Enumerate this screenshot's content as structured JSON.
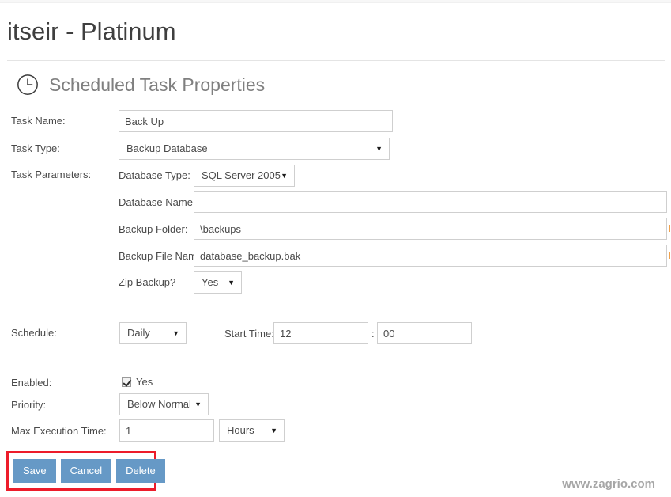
{
  "window": {
    "brand": "itseir - Platinum",
    "page_title": "Scheduled Task Properties",
    "title_icon": "clock-icon"
  },
  "form": {
    "task_name": {
      "label": "Task Name:",
      "value": "Back Up",
      "placeholder": ""
    },
    "task_type": {
      "label": "Task Type:",
      "value": "Backup Database",
      "caret": "▼"
    },
    "task_parameters": {
      "label": "Task Parameters:",
      "database_type": {
        "label": "Database Type:",
        "value": "SQL Server 2005",
        "caret": "▼"
      },
      "database_name": {
        "label": "Database Name:",
        "value": "",
        "placeholder": ""
      },
      "backup_folder": {
        "label": "Backup Folder:",
        "value": "\\backups",
        "placeholder": ""
      },
      "backup_file_name": {
        "label": "Backup File Name:",
        "value": "database_backup.bak",
        "placeholder": ""
      },
      "zip_backup": {
        "label": "Zip Backup?",
        "value": "Yes",
        "caret": "▼"
      }
    },
    "schedule": {
      "label": "Schedule:",
      "value": "Daily",
      "caret": "▼"
    },
    "start_time": {
      "label": "Start Time:",
      "hours": "12",
      "separator": ":",
      "minutes": "00"
    },
    "enabled": {
      "label": "Enabled:",
      "checkbox_label": "Yes",
      "checked": true
    },
    "priority": {
      "label": "Priority:",
      "value": "Below Normal",
      "caret": "▼"
    },
    "max_execution_time": {
      "label": "Max Execution Time:",
      "value": "1",
      "unit": "Hours",
      "caret": "▼"
    }
  },
  "actions": {
    "save": "Save",
    "cancel": "Cancel",
    "delete": "Delete"
  },
  "watermark": "www.zagrio.com",
  "colors": {
    "button_blue": "#6699c6",
    "highlight_red": "#ed1c2a",
    "required_orange": "#f0a14b",
    "title_gray": "#7f7f7f",
    "brand_gray": "#3f3f3f"
  }
}
